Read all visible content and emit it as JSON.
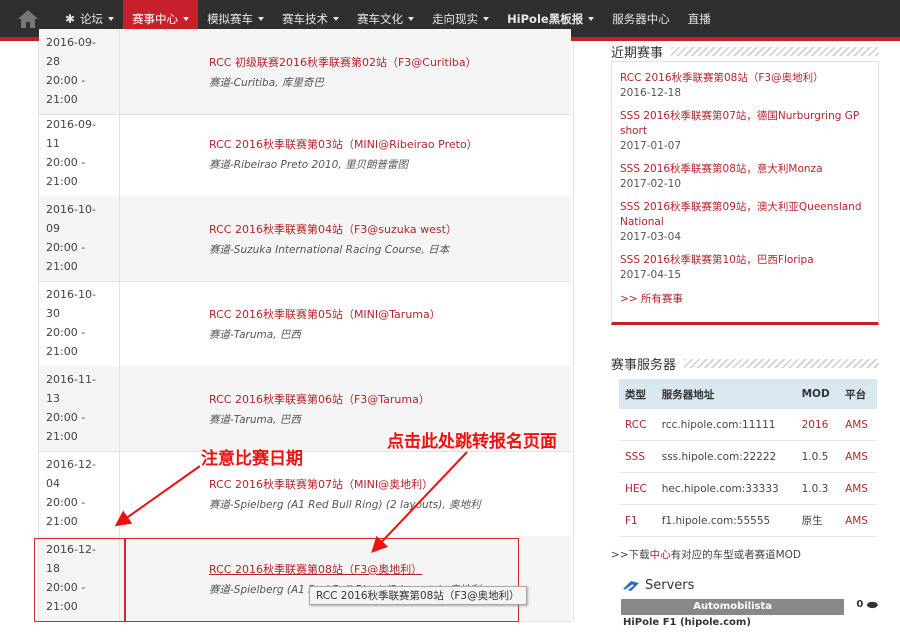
{
  "nav": {
    "items": [
      {
        "label": "论坛",
        "star": true,
        "caret": true
      },
      {
        "label": "赛事中心",
        "caret": true,
        "active": true
      },
      {
        "label": "模拟赛车",
        "caret": true
      },
      {
        "label": "赛车技术",
        "caret": true
      },
      {
        "label": "赛车文化",
        "caret": true
      },
      {
        "label": "走向现实",
        "caret": true
      },
      {
        "label": "HiPole黑板报",
        "caret": true,
        "bold": true
      },
      {
        "label": "服务器中心",
        "caret": false
      },
      {
        "label": "直播",
        "caret": false
      }
    ]
  },
  "schedule": [
    {
      "date": [
        "2016-09-",
        "28",
        "20:00 -",
        "21:00"
      ],
      "title": "RCC 初级联赛2016秋季联赛第02站（F3@Curitiba）",
      "track": "赛道-Curitiba, 库里奇巴"
    },
    {
      "date": [
        "2016-09-",
        "11",
        "20:00 -",
        "21:00"
      ],
      "title": "RCC 2016秋季联赛第03站（MINI@Ribeirao Preto）",
      "track": "赛道-Ribeirao Preto 2010, 里贝朗普雷图"
    },
    {
      "date": [
        "2016-10-",
        "09",
        "20:00 -",
        "21:00"
      ],
      "title": "RCC 2016秋季联赛第04站（F3@suzuka west）",
      "track": "赛道-Suzuka International Racing Course, 日本"
    },
    {
      "date": [
        "2016-10-",
        "30",
        "20:00 -",
        "21:00"
      ],
      "title": "RCC 2016秋季联赛第05站（MINI@Taruma）",
      "track": "赛道-Taruma, 巴西"
    },
    {
      "date": [
        "2016-11-",
        "13",
        "20:00 -",
        "21:00"
      ],
      "title": "RCC 2016秋季联赛第06站（F3@Taruma）",
      "track": "赛道-Taruma, 巴西"
    },
    {
      "date": [
        "2016-12-",
        "04",
        "20:00 -",
        "21:00"
      ],
      "title": "RCC 2016秋季联赛第07站（MINI@奥地利）",
      "track": "赛道-Spielberg (A1 Red Bull Ring) (2 layouts), 奥地利"
    },
    {
      "date": [
        "2016-12-",
        "18",
        "20:00 -",
        "21:00"
      ],
      "title": "RCC 2016秋季联赛第08站（F3@奥地利）",
      "track": "赛道-Spielberg (A1 Red Bull Ring) (2 layouts), 奥地利"
    }
  ],
  "annotations": {
    "left": "注意比赛日期",
    "right": "点击此处跳转报名页面"
  },
  "tooltip": "RCC 2016秋季联赛第08站（F3@奥地利）",
  "sidebar": {
    "recent_title": "近期赛事",
    "recent": [
      {
        "title": "RCC 2016秋季联赛第08站（F3@奥地利）",
        "date": "2016-12-18"
      },
      {
        "title": "SSS 2016秋季联赛第07站，德国Nurburgring GP short",
        "date": "2017-01-07"
      },
      {
        "title": "SSS 2016秋季联赛第08站，意大利Monza",
        "date": "2017-02-10"
      },
      {
        "title": "SSS 2016秋季联赛第09站，澳大利亚Queensland National",
        "date": "2017-03-04"
      },
      {
        "title": "SSS 2016秋季联赛第10站，巴西Floripa",
        "date": "2017-04-15"
      }
    ],
    "all_link": ">> 所有赛事",
    "servers_title": "赛事服务器",
    "server_headers": [
      "类型",
      "服务器地址",
      "MOD",
      "平台"
    ],
    "servers": [
      [
        "RCC",
        "rcc.hipole.com:11111",
        "2016",
        "AMS"
      ],
      [
        "SSS",
        "sss.hipole.com:22222",
        "1.0.5",
        "AMS"
      ],
      [
        "HEC",
        "hec.hipole.com:33333",
        "1.0.3",
        "AMS"
      ],
      [
        "F1",
        "f1.hipole.com:55555",
        "原生",
        "AMS"
      ]
    ],
    "download_note_prefix": ">>下载",
    "download_note_link": "中心",
    "download_note_suffix": "有对应的车型或者赛道MOD",
    "servers_widget_title": "Servers",
    "servers_widget_game": "Automobilista",
    "servers_widget_count": "0",
    "servers_widget_entry": "HiPole F1 (hipole.com)"
  },
  "colors": {
    "accent": "#c8202a",
    "nav_bg": "#2f2f2f",
    "link": "#b2242b"
  }
}
